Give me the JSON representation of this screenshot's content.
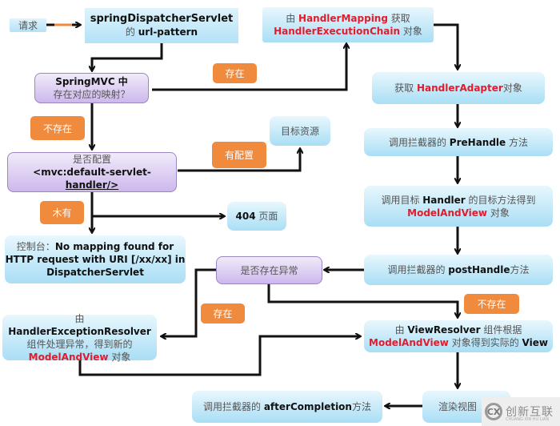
{
  "nodes": {
    "request": "请求",
    "dispatcher_l1": "springDispatcherServlet",
    "dispatcher_l2_pre": "的 ",
    "dispatcher_l2": "url-pattern",
    "mapping_q_l1": "SpringMVC 中",
    "mapping_q_l2": "存在对应的映射？",
    "handler_mapping_pre": "由 ",
    "handler_mapping_red": "HandlerMapping",
    "handler_mapping_post": " 获取",
    "handler_chain_red": "HandlerExecutionChain",
    "handler_chain_post": " 对象",
    "adapter_pre": "获取 ",
    "adapter_red": "HandlerAdapter",
    "adapter_post": "对象",
    "prehandle_pre": "调用拦截器的 ",
    "prehandle_bold": "PreHandle",
    "prehandle_post": " 方法",
    "target_resource": "目标资源",
    "default_servlet_l1": "是否配置",
    "default_servlet_l2": "<mvc:default-servlet-",
    "default_servlet_l3": "handler/>",
    "invoke_pre": "调用目标 ",
    "invoke_bold": "Handler",
    "invoke_post": " 的目标方法得到",
    "invoke_red": "ModelAndView",
    "invoke_post2": " 对象",
    "page404_bold": "404",
    "page404_post": " 页面",
    "console_pre": "控制台：",
    "console_l1": "No mapping found for",
    "console_l2": "HTTP request with URI [/xx/xx] in",
    "console_l3": "DispatcherServlet",
    "exception_q": "是否存在异常",
    "posthandle_pre": "调用拦截器的 ",
    "posthandle_bold": "postHandle",
    "posthandle_post": "方法",
    "exres_pre": "由 ",
    "exres_bold": "HandlerExceptionResolver",
    "exres_l2": "组件处理异常，得到新的",
    "exres_red": "ModelAndView",
    "exres_post": " 对象",
    "viewres_pre": "由 ",
    "viewres_bold": "ViewResolver",
    "viewres_post": " 组件根据",
    "viewres_red": "ModelAndView",
    "viewres_post2": " 对象得到实际的 ",
    "viewres_bold2": "View",
    "after_pre": "调用拦截器的 ",
    "after_bold": "afterCompletion",
    "after_post": "方法",
    "render": "渲染视图"
  },
  "labels": {
    "exists_top": "存在",
    "not_exists_left": "不存在",
    "configured": "有配置",
    "not_configured": "木有",
    "exists_exception": "存在",
    "not_exists_exception": "不存在"
  },
  "watermark": {
    "logo": "CX",
    "text": "创新互联",
    "sub": "CHUANG XIN HU LIAN"
  },
  "colors": {
    "accent_red": "#e21c2c",
    "label_orange": "#f08a3c",
    "node_blue": "#a9def5",
    "node_purple": "#cdb8ec"
  }
}
